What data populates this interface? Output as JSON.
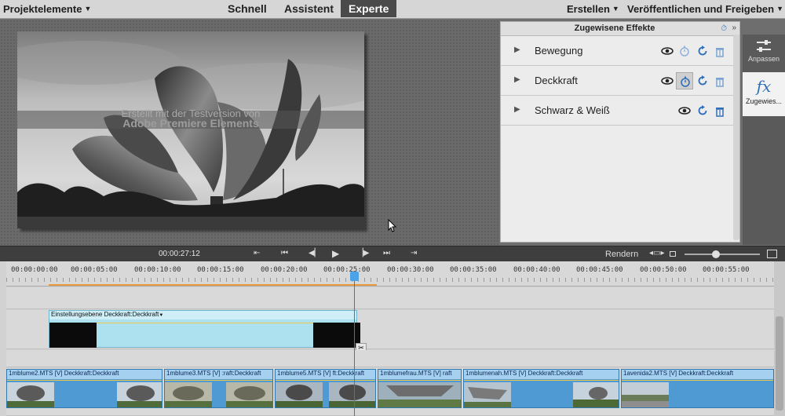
{
  "topbar": {
    "project_menu": "Projektelemente",
    "tabs": [
      {
        "label": "Schnell"
      },
      {
        "label": "Assistent"
      },
      {
        "label": "Experte"
      }
    ],
    "create_menu": "Erstellen",
    "publish_menu": "Veröffentlichen und Freigeben"
  },
  "monitor": {
    "watermark_line1": "Erstellt mit der Testversion von",
    "watermark_line2": "Adobe Premiere Elements",
    "timecode": "00:00:27:12"
  },
  "effects": {
    "title": "Zugewisene Effekte",
    "items": [
      {
        "label": "Bewegung"
      },
      {
        "label": "Deckkraft"
      },
      {
        "label": "Schwarz & Weiß"
      }
    ]
  },
  "tools": {
    "adjust_label": "Anpassen",
    "applied_label": "Zugewies..."
  },
  "transport": {
    "render_label": "Rendern"
  },
  "timeline": {
    "ruler_labels": [
      "00:00:00:00",
      "00:00:05:00",
      "00:00:10:00",
      "00:00:15:00",
      "00:00:20:00",
      "00:00:25:00",
      "00:00:30:00",
      "00:00:35:00",
      "00:00:40:00",
      "00:00:45:00",
      "00:00:50:00",
      "00:00:55:00"
    ],
    "adjustment_clip": "Einstellungsebene Deckkraft:Deckkraft",
    "video_clips": [
      {
        "label": "1mblume2.MTS [V] Deckkraft:Deckkraft"
      },
      {
        "label": "1mblume3.MTS [V] :raft:Deckkraft"
      },
      {
        "label": "1mblume5.MTS [V] ft:Deckkraft"
      },
      {
        "label": "1mblumefrau.MTS [V] raft"
      },
      {
        "label": "1mblumenah.MTS [V] Deckkraft:Deckkraft"
      },
      {
        "label": "1avenida2.MTS [V] Deckkraft:Deckkraft"
      }
    ]
  },
  "colors": {
    "accent": "#4aa3e8",
    "playline": "#e23b3b",
    "clip_video": "#4f9ad2",
    "clip_adjust": "#aee1ef"
  }
}
